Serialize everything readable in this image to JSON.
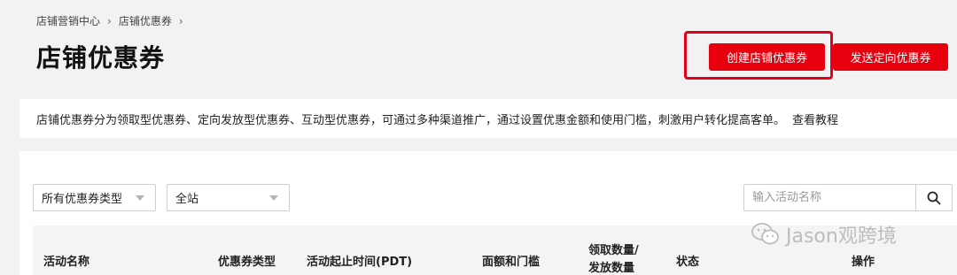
{
  "breadcrumb": [
    "店铺营销中心",
    "店铺优惠券"
  ],
  "page_title": "店铺优惠券",
  "actions": {
    "create_label": "创建店铺优惠券",
    "send_label": "发送定向优惠券"
  },
  "info": {
    "text": "店铺优惠券分为领取型优惠券、定向发放型优惠券、互动型优惠券，可通过多种渠道推广，通过设置优惠金额和使用门槛，刺激用户转化提高客单。",
    "link": "查看教程"
  },
  "filters": {
    "type_value": "所有优惠券类型",
    "site_value": "全站",
    "search_placeholder": "输入活动名称"
  },
  "table": {
    "headers": [
      "活动名称",
      "优惠券类型",
      "活动起止时间(PDT)",
      "面额和门槛",
      "领取数量/",
      "发放数量",
      "状态",
      "操作"
    ]
  },
  "watermark": "Jason观跨境",
  "colors": {
    "accent": "#e8000f",
    "highlight": "#e0001b"
  }
}
